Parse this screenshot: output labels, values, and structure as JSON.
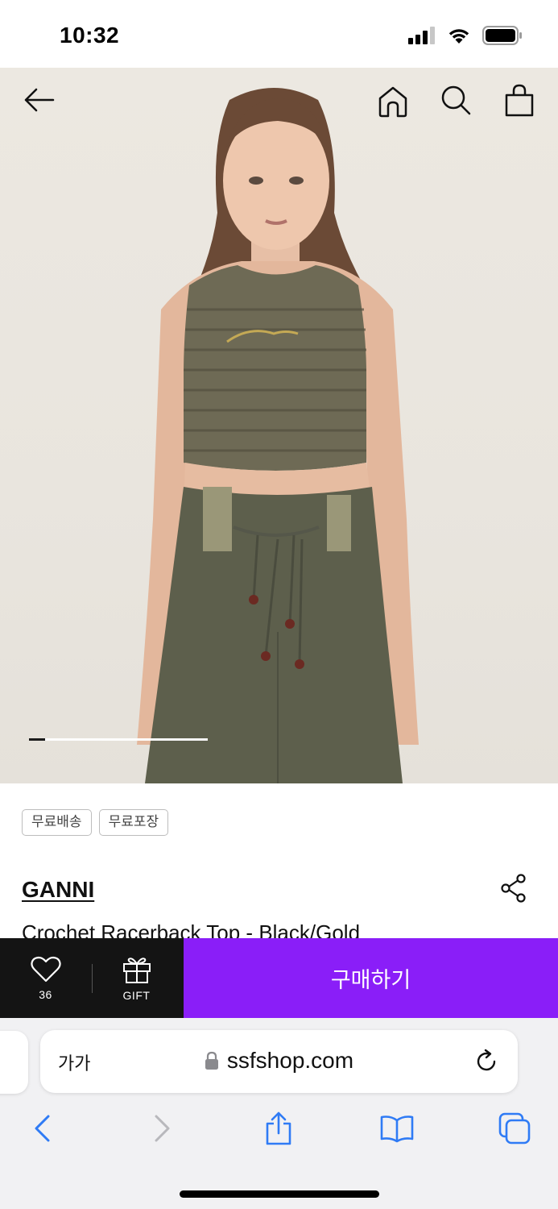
{
  "status_bar": {
    "time": "10:32"
  },
  "header": {
    "back_icon": "arrow-left-icon",
    "home_icon": "home-icon",
    "search_icon": "search-icon",
    "cart_icon": "shopping-bag-icon"
  },
  "gallery": {
    "progress_fraction": 0.09
  },
  "product": {
    "tags": [
      "무료배송",
      "무료포장"
    ],
    "brand": "GANNI",
    "name": "Crochet Racerback Top - Black/Gold"
  },
  "purchase_bar": {
    "like_count": "36",
    "gift_label": "GIFT",
    "buy_label": "구매하기",
    "buy_color": "#8a1ef8"
  },
  "browser": {
    "text_size_label": "가가",
    "url": "ssfshop.com"
  }
}
